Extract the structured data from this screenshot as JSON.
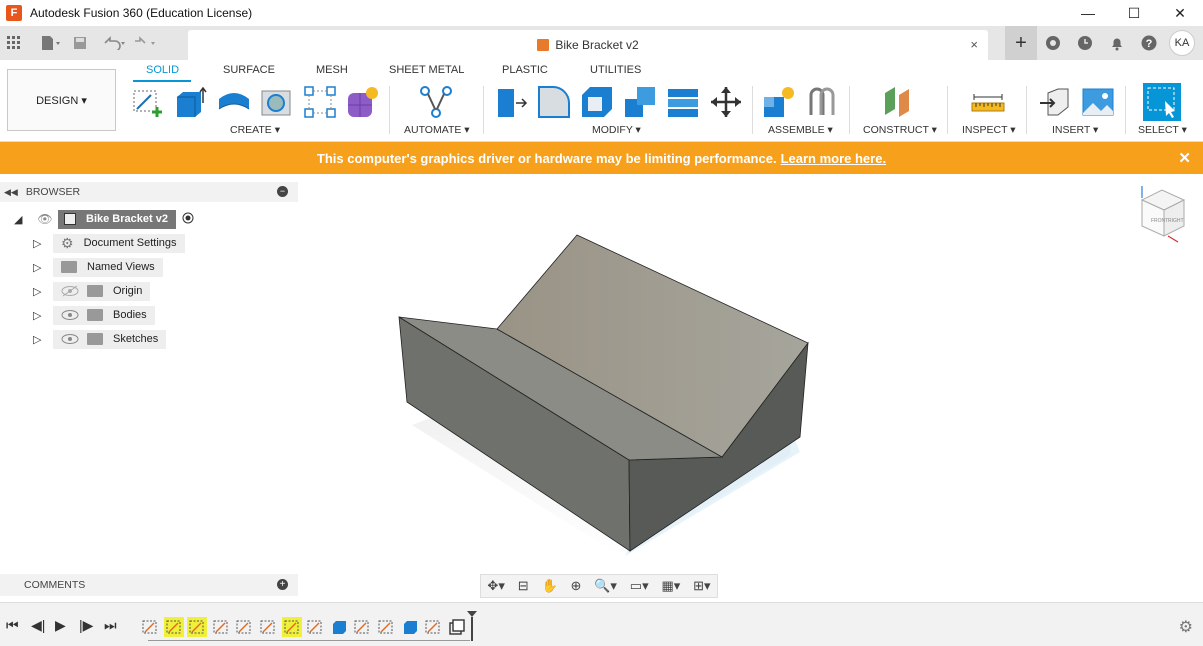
{
  "window": {
    "app_icon": "F",
    "title": "Autodesk Fusion 360 (Education License)",
    "controls": {
      "minimize": "—",
      "maximize": "☐",
      "close": "✕"
    }
  },
  "tabbar": {
    "document_tab": "Bike Bracket v2",
    "close": "×",
    "new_tab": "+",
    "avatar": "KA"
  },
  "ribbon": {
    "workspace": "DESIGN ▾",
    "tabs": [
      "SOLID",
      "SURFACE",
      "MESH",
      "SHEET METAL",
      "PLASTIC",
      "UTILITIES"
    ],
    "groups": [
      "CREATE ▾",
      "AUTOMATE ▾",
      "MODIFY ▾",
      "ASSEMBLE ▾",
      "CONSTRUCT ▾",
      "INSPECT ▾",
      "INSERT ▾",
      "SELECT ▾"
    ],
    "accent_color": "#0696d7"
  },
  "warning": {
    "message": "This computer's graphics driver or hardware may be limiting performance.",
    "link": "Learn more here.",
    "close": "✕",
    "color": "#f7a01c"
  },
  "browser": {
    "header": "BROWSER",
    "collapse": "−",
    "root": "Bike Bracket v2",
    "items": [
      "Document Settings",
      "Named Views",
      "Origin",
      "Bodies",
      "Sketches"
    ]
  },
  "comments": {
    "label": "COMMENTS",
    "add": "+"
  },
  "viewcube": {
    "front": "FRONT",
    "right": "RIGHT",
    "top": "TOP"
  },
  "timeline": {
    "controls": [
      "skip-to-start",
      "step-back",
      "play",
      "step-forward",
      "skip-to-end"
    ],
    "items": [
      "sketch",
      "sketch-highlighted",
      "sketch-highlighted",
      "sketch",
      "sketch",
      "sketch",
      "sketch-highlighted",
      "sketch",
      "extrude",
      "sketch",
      "sketch",
      "extrude",
      "sketch",
      "feature"
    ]
  }
}
